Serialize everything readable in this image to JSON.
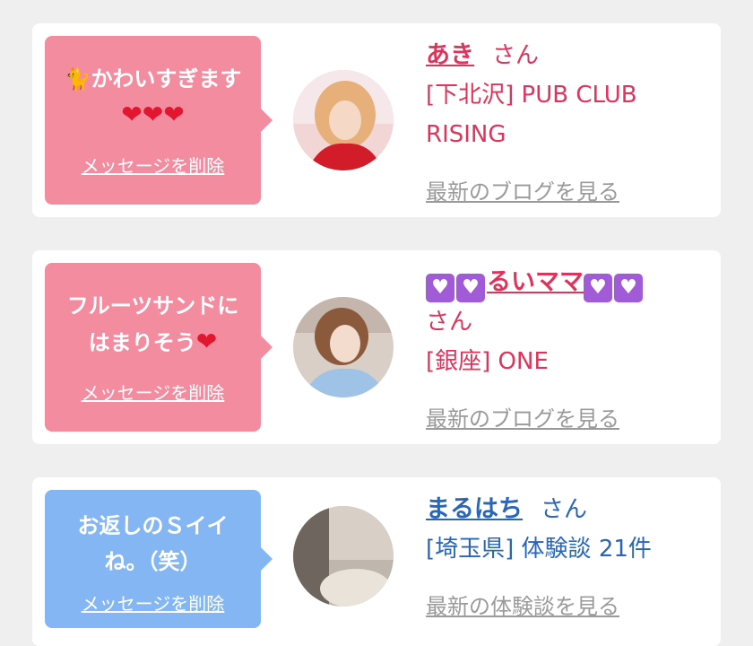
{
  "colors": {
    "pink_bubble": "#f48ca0",
    "blue_bubble": "#84b6f4",
    "pink_text": "#e0335b",
    "blue_text": "#2a66b8",
    "link_gray": "#9a9a9a"
  },
  "cards": [
    {
      "message_line1": "かわいすぎます",
      "message_emoji": "🐈",
      "message_hearts": "❤❤❤",
      "delete_label": "メッセージを削除",
      "name": "あき",
      "honorific": "さん",
      "shop": "[下北沢] PUB CLUB RISING",
      "more_label": "最新のブログを見る"
    },
    {
      "message_line1": "フルーツサンドに",
      "message_line2": "はまりそう",
      "message_heart": "❤",
      "delete_label": "メッセージを削除",
      "name": "るいママ",
      "name_hearts": "♥",
      "honorific": "さん",
      "shop": "[銀座] ONE",
      "more_label": "最新のブログを見る"
    },
    {
      "message_line1": "お返しのＳイイ",
      "message_line2": "ね。（笑）",
      "delete_label": "メッセージを削除",
      "name": "まるはち",
      "honorific": "さん",
      "shop": "[埼玉県] 体験談 21件",
      "more_label": "最新の体験談を見る"
    }
  ]
}
